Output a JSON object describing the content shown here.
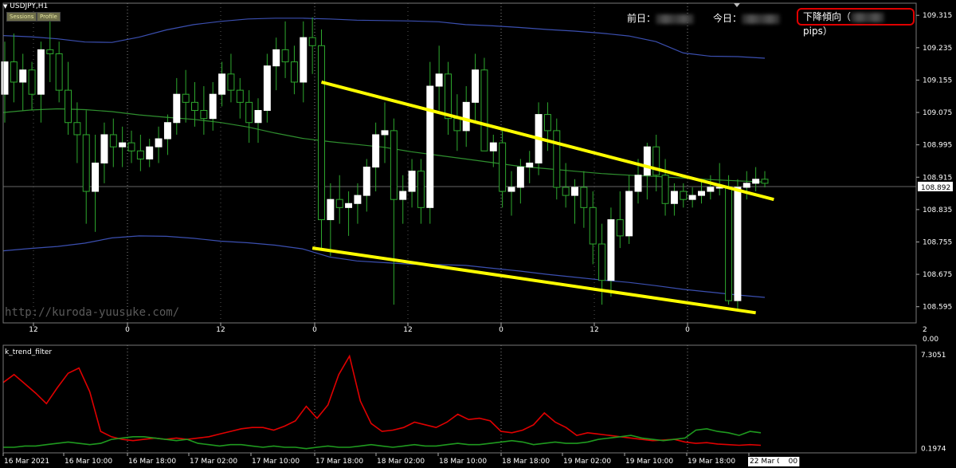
{
  "window": {
    "symbol_timeframe": "USDJPY,H1",
    "buttons": [
      "Sessions",
      "Profile"
    ]
  },
  "header": {
    "prev_day_label": "前日：",
    "today_label": "今日：",
    "trend_label": "下降傾向（",
    "trend_unit": "pips）"
  },
  "watermark": "http://kuroda-yuusuke.com/",
  "colors": {
    "background": "#000000",
    "bull_candle": "#ffffff",
    "bear_candle": "#000000",
    "candle_wick": "#2ea82e",
    "bollinger_band": "#3b4fb0",
    "moving_average": "#2f8f2f",
    "trend_lines": "#ffff00",
    "indicator_red": "#e00000",
    "indicator_green": "#1f9a1f",
    "trend_box": "#e00000"
  },
  "chart_data": [
    {
      "type": "candlestick",
      "symbol": "USDJPY",
      "timeframe": "H1",
      "price_axis": {
        "ticks": [
          "109.315",
          "109.235",
          "109.155",
          "109.075",
          "108.995",
          "108.915",
          "108.835",
          "108.755",
          "108.675",
          "108.595"
        ],
        "current_price": "108.892",
        "ylim": [
          108.555,
          109.345
        ]
      },
      "time_axis_top": [
        "12",
        "0",
        "12",
        "0",
        "12",
        "0",
        "12",
        "0"
      ],
      "upper_band": [
        109.265,
        109.262,
        109.257,
        109.249,
        109.248,
        109.261,
        109.279,
        109.292,
        109.3,
        109.306,
        109.308,
        109.308,
        109.306,
        109.303,
        109.302,
        109.301,
        109.299,
        109.292,
        109.289,
        109.285,
        109.28,
        109.276,
        109.271,
        109.264,
        109.25,
        109.222,
        109.214,
        109.213,
        109.209
      ],
      "middle_ma": [
        109.075,
        109.081,
        109.084,
        109.082,
        109.077,
        109.069,
        109.063,
        109.058,
        109.05,
        109.039,
        109.024,
        109.011,
        109.003,
        108.996,
        108.989,
        108.978,
        108.969,
        108.96,
        108.951,
        108.942,
        108.936,
        108.93,
        108.924,
        108.92,
        108.917,
        108.913,
        108.909,
        108.906,
        108.903
      ],
      "lower_band": [
        108.733,
        108.739,
        108.744,
        108.752,
        108.765,
        108.77,
        108.769,
        108.764,
        108.757,
        108.753,
        108.747,
        108.738,
        108.718,
        108.708,
        108.704,
        108.7,
        108.699,
        108.697,
        108.69,
        108.683,
        108.675,
        108.668,
        108.661,
        108.655,
        108.647,
        108.638,
        108.631,
        108.624,
        108.618
      ],
      "ohlc": [
        [
          109.12,
          109.25,
          109.05,
          109.2
        ],
        [
          109.2,
          109.27,
          109.1,
          109.15
        ],
        [
          109.15,
          109.22,
          109.08,
          109.18
        ],
        [
          109.18,
          109.2,
          109.08,
          109.12
        ],
        [
          109.12,
          109.25,
          109.05,
          109.23
        ],
        [
          109.23,
          109.3,
          109.15,
          109.22
        ],
        [
          109.22,
          109.25,
          109.1,
          109.13
        ],
        [
          109.13,
          109.2,
          109.02,
          109.05
        ],
        [
          109.05,
          109.1,
          108.95,
          109.02
        ],
        [
          109.02,
          109.08,
          108.8,
          108.88
        ],
        [
          108.88,
          109.02,
          108.78,
          108.95
        ],
        [
          108.95,
          109.05,
          108.9,
          109.02
        ],
        [
          109.02,
          109.06,
          108.94,
          108.99
        ],
        [
          108.99,
          109.04,
          108.94,
          109.0
        ],
        [
          109.0,
          109.03,
          108.95,
          108.98
        ],
        [
          108.98,
          109.02,
          108.93,
          108.96
        ],
        [
          108.96,
          109.01,
          108.94,
          108.99
        ],
        [
          108.99,
          109.04,
          108.95,
          109.01
        ],
        [
          109.01,
          109.07,
          108.97,
          109.05
        ],
        [
          109.05,
          109.16,
          109.02,
          109.12
        ],
        [
          109.12,
          109.18,
          109.05,
          109.1
        ],
        [
          109.1,
          109.15,
          109.04,
          109.08
        ],
        [
          109.08,
          109.14,
          109.02,
          109.06
        ],
        [
          109.06,
          109.15,
          109.03,
          109.12
        ],
        [
          109.12,
          109.2,
          109.09,
          109.17
        ],
        [
          109.17,
          109.22,
          109.1,
          109.13
        ],
        [
          109.13,
          109.16,
          109.06,
          109.1
        ],
        [
          109.1,
          109.13,
          109.0,
          109.05
        ],
        [
          109.05,
          109.11,
          109.0,
          109.08
        ],
        [
          109.08,
          109.22,
          109.05,
          109.19
        ],
        [
          109.19,
          109.26,
          109.13,
          109.23
        ],
        [
          109.23,
          109.3,
          109.16,
          109.2
        ],
        [
          109.2,
          109.24,
          109.12,
          109.15
        ],
        [
          109.15,
          109.3,
          109.1,
          109.26
        ],
        [
          109.26,
          109.31,
          109.17,
          109.24
        ],
        [
          109.24,
          109.28,
          108.74,
          108.81
        ],
        [
          108.81,
          108.9,
          108.72,
          108.86
        ],
        [
          108.86,
          108.92,
          108.8,
          108.84
        ],
        [
          108.84,
          108.88,
          108.77,
          108.85
        ],
        [
          108.85,
          108.9,
          108.8,
          108.87
        ],
        [
          108.87,
          108.96,
          108.83,
          108.94
        ],
        [
          108.94,
          109.05,
          108.88,
          109.02
        ],
        [
          109.02,
          109.1,
          108.95,
          109.03
        ],
        [
          109.03,
          109.06,
          108.6,
          108.86
        ],
        [
          108.86,
          108.92,
          108.8,
          108.88
        ],
        [
          108.88,
          108.96,
          108.84,
          108.93
        ],
        [
          108.93,
          108.96,
          108.8,
          108.84
        ],
        [
          108.84,
          109.2,
          108.8,
          109.14
        ],
        [
          109.14,
          109.24,
          109.08,
          109.17
        ],
        [
          109.17,
          109.2,
          109.02,
          109.06
        ],
        [
          109.06,
          109.12,
          108.98,
          109.03
        ],
        [
          109.03,
          109.14,
          108.99,
          109.1
        ],
        [
          109.1,
          109.22,
          109.05,
          109.18
        ],
        [
          109.18,
          109.21,
          109.02,
          108.98
        ],
        [
          108.98,
          109.02,
          108.94,
          109.0
        ],
        [
          109.0,
          109.03,
          108.84,
          108.88
        ],
        [
          108.88,
          108.93,
          108.82,
          108.89
        ],
        [
          108.89,
          108.96,
          108.85,
          108.94
        ],
        [
          108.94,
          108.98,
          108.9,
          108.95
        ],
        [
          108.95,
          109.1,
          108.92,
          109.07
        ],
        [
          109.07,
          109.1,
          108.98,
          109.03
        ],
        [
          109.03,
          109.06,
          108.86,
          108.89
        ],
        [
          108.89,
          108.95,
          108.84,
          108.87
        ],
        [
          108.87,
          108.91,
          108.8,
          108.89
        ],
        [
          108.89,
          108.93,
          108.79,
          108.84
        ],
        [
          108.84,
          108.88,
          108.7,
          108.75
        ],
        [
          108.75,
          108.8,
          108.6,
          108.66
        ],
        [
          108.66,
          108.84,
          108.62,
          108.81
        ],
        [
          108.81,
          108.88,
          108.74,
          108.77
        ],
        [
          108.77,
          108.92,
          108.75,
          108.88
        ],
        [
          108.88,
          108.96,
          108.85,
          108.92
        ],
        [
          108.92,
          109.0,
          108.86,
          108.99
        ],
        [
          108.99,
          109.02,
          108.88,
          108.92
        ],
        [
          108.92,
          108.96,
          108.82,
          108.85
        ],
        [
          108.85,
          108.9,
          108.82,
          108.88
        ],
        [
          108.88,
          108.9,
          108.84,
          108.86
        ],
        [
          108.86,
          108.89,
          108.84,
          108.87
        ],
        [
          108.87,
          108.91,
          108.85,
          108.88
        ],
        [
          108.88,
          108.92,
          108.86,
          108.89
        ],
        [
          108.89,
          108.95,
          108.87,
          108.89
        ],
        [
          108.89,
          108.92,
          108.6,
          108.61
        ],
        [
          108.61,
          108.91,
          108.59,
          108.89
        ],
        [
          108.89,
          108.93,
          108.86,
          108.9
        ],
        [
          108.9,
          108.94,
          108.88,
          108.91
        ],
        [
          108.91,
          108.93,
          108.89,
          108.9
        ]
      ],
      "trend_lines": [
        {
          "name": "upper",
          "from": [
            35,
            109.15
          ],
          "to": [
            85,
            108.86
          ]
        },
        {
          "name": "lower",
          "from": [
            34,
            108.74
          ],
          "to": [
            83,
            108.58
          ]
        }
      ],
      "grid": "dotted vertical at day boundaries"
    },
    {
      "type": "line",
      "indicator": "k_trend_filter",
      "y_ticks": [
        "7.3051",
        "0.1974"
      ],
      "ylim": [
        0,
        7.6
      ],
      "x_labels": [
        "16 Mar 2021",
        "16 Mar 10:00",
        "16 Mar 18:00",
        "17 Mar 02:00",
        "17 Mar 10:00",
        "17 Mar 18:00",
        "18 Mar 02:00",
        "18 Mar 10:00",
        "18 Mar 18:00",
        "19 Mar 02:00",
        "19 Mar 10:00",
        "19 Mar 18:00",
        "22 Mar 02:00"
      ],
      "series": [
        {
          "values": [
            5.2,
            5.8,
            5.1,
            4.4,
            3.6,
            4.8,
            5.9,
            6.3,
            4.5,
            1.5,
            1.1,
            0.9,
            0.8,
            0.9,
            1.0,
            0.9,
            1.0,
            0.9,
            1.0,
            1.1,
            1.3,
            1.5,
            1.7,
            1.8,
            1.8,
            1.6,
            1.9,
            2.3,
            3.4,
            2.5,
            3.5,
            5.8,
            7.2,
            3.8,
            2.1,
            1.5,
            1.6,
            1.8,
            2.2,
            2.0,
            1.8,
            2.2,
            2.8,
            2.4,
            2.5,
            2.3,
            1.5,
            1.4,
            1.6,
            2.0,
            2.9,
            2.2,
            1.8,
            1.2,
            1.4,
            1.3,
            1.2,
            1.1,
            1.0,
            0.9,
            0.8,
            0.85,
            0.9,
            0.7,
            0.6,
            0.65,
            0.55,
            0.5,
            0.45,
            0.5,
            0.45
          ]
        },
        {
          "values": [
            0.3,
            0.3,
            0.4,
            0.4,
            0.5,
            0.6,
            0.7,
            0.6,
            0.5,
            0.6,
            0.9,
            1.0,
            1.1,
            1.1,
            1.0,
            0.9,
            0.8,
            0.9,
            0.6,
            0.5,
            0.4,
            0.5,
            0.5,
            0.4,
            0.3,
            0.4,
            0.3,
            0.3,
            0.2,
            0.3,
            0.4,
            0.3,
            0.3,
            0.4,
            0.5,
            0.4,
            0.3,
            0.4,
            0.5,
            0.4,
            0.4,
            0.5,
            0.6,
            0.5,
            0.5,
            0.6,
            0.7,
            0.8,
            0.7,
            0.5,
            0.6,
            0.7,
            0.6,
            0.6,
            0.7,
            0.9,
            1.0,
            1.1,
            1.2,
            1.0,
            0.9,
            0.8,
            0.9,
            1.0,
            1.6,
            1.7,
            1.5,
            1.4,
            1.2,
            1.5,
            1.4
          ]
        }
      ]
    }
  ]
}
